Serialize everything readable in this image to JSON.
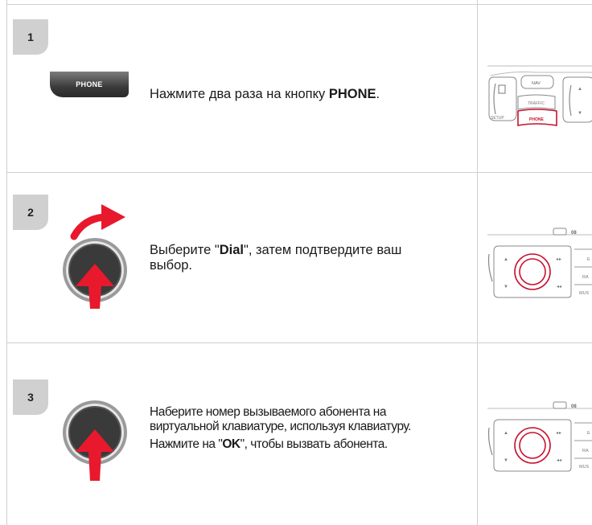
{
  "steps": [
    {
      "number": "1",
      "button_label": "PHONE",
      "text_before": "Нажмите два раза на кнопку ",
      "text_bold": "PHONE",
      "text_after": ".",
      "thumbnail": {
        "labels": [
          "NAV",
          "TRAFFIC",
          "PHONE",
          "SETUP"
        ],
        "accent_color": "#c8102e"
      }
    },
    {
      "number": "2",
      "text_before": "Выберите \"",
      "text_bold": "Dial",
      "text_after": "\", затем подтвердите ваш выбор.",
      "thumbnail": {
        "labels": [
          "RA",
          "MUS",
          "E",
          "08"
        ],
        "accent_color": "#c8102e"
      }
    },
    {
      "number": "3",
      "line1": "Наберите номер вызываемого абонента на виртуальной клавиатуре, используя клавиатуру.",
      "line2_before": "Нажмите на \"",
      "line2_bold": "OK",
      "line2_after": "\", чтобы вызвать абонента.",
      "thumbnail": {
        "labels": [
          "RA",
          "MUS",
          "E",
          "08"
        ],
        "accent_color": "#c8102e"
      }
    }
  ],
  "colors": {
    "accent": "#e8192c",
    "badge": "#d0d0d0",
    "knob_dark": "#3a3a3a"
  }
}
